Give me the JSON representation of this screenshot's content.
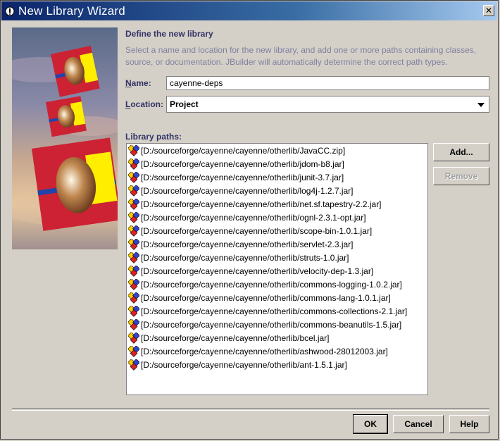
{
  "window": {
    "title": "New Library Wizard",
    "close_label": "✕"
  },
  "header": {
    "section_title": "Define the new library",
    "description": "Select a name and location for the new library, and add one or more paths containing classes, source, or documentation. JBuilder will automatically determine the correct path types."
  },
  "form": {
    "name_label_accel": "N",
    "name_label_rest": "ame:",
    "name_value": "cayenne-deps",
    "location_label_accel": "L",
    "location_label_rest": "ocation:",
    "location_value": "Project",
    "library_paths_label": "Library paths:"
  },
  "library_paths": [
    "[D:/sourceforge/cayenne/cayenne/otherlib/JavaCC.zip]",
    "[D:/sourceforge/cayenne/cayenne/otherlib/jdom-b8.jar]",
    "[D:/sourceforge/cayenne/cayenne/otherlib/junit-3.7.jar]",
    "[D:/sourceforge/cayenne/cayenne/otherlib/log4j-1.2.7.jar]",
    "[D:/sourceforge/cayenne/cayenne/otherlib/net.sf.tapestry-2.2.jar]",
    "[D:/sourceforge/cayenne/cayenne/otherlib/ognl-2.3.1-opt.jar]",
    "[D:/sourceforge/cayenne/cayenne/otherlib/scope-bin-1.0.1.jar]",
    "[D:/sourceforge/cayenne/cayenne/otherlib/servlet-2.3.jar]",
    "[D:/sourceforge/cayenne/cayenne/otherlib/struts-1.0.jar]",
    "[D:/sourceforge/cayenne/cayenne/otherlib/velocity-dep-1.3.jar]",
    "[D:/sourceforge/cayenne/cayenne/otherlib/commons-logging-1.0.2.jar]",
    "[D:/sourceforge/cayenne/cayenne/otherlib/commons-lang-1.0.1.jar]",
    "[D:/sourceforge/cayenne/cayenne/otherlib/commons-collections-2.1.jar]",
    "[D:/sourceforge/cayenne/cayenne/otherlib/commons-beanutils-1.5.jar]",
    "[D:/sourceforge/cayenne/cayenne/otherlib/bcel.jar]",
    "[D:/sourceforge/cayenne/cayenne/otherlib/ashwood-28012003.jar]",
    "[D:/sourceforge/cayenne/cayenne/otherlib/ant-1.5.1.jar]"
  ],
  "buttons": {
    "add": "Add...",
    "remove": "Remove",
    "ok": "OK",
    "cancel": "Cancel",
    "help": "Help"
  },
  "icons": {
    "title": "jbuilder-icon",
    "library": "library-icon",
    "close": "close-icon"
  },
  "colors": {
    "titlebar_start": "#0a246a",
    "titlebar_end": "#a6caf0",
    "label_text": "#333366",
    "description_text": "#8080a0",
    "dialog_bg": "#d4d0c8"
  }
}
